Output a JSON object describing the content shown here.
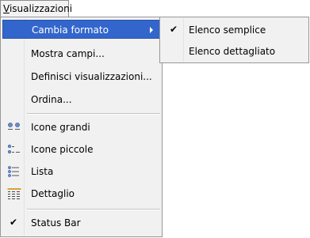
{
  "menubar": {
    "title": "Visualizzazioni",
    "mnemonic": "V",
    "rest": "isualizzazioni"
  },
  "menu": {
    "items": [
      {
        "label": "Cambia formato",
        "has_submenu": true,
        "highlighted": true
      },
      {
        "label": "Mostra campi..."
      },
      {
        "label": "Definisci visualizzazioni..."
      },
      {
        "label": "Ordina..."
      },
      {
        "label": "Icone grandi",
        "icon": "large-icons-icon"
      },
      {
        "label": "Icone piccole",
        "icon": "small-icons-icon"
      },
      {
        "label": "Lista",
        "icon": "list-icon"
      },
      {
        "label": "Dettaglio",
        "icon": "details-icon"
      },
      {
        "label": "Status Bar",
        "checked": true
      }
    ]
  },
  "submenu": {
    "items": [
      {
        "label": "Elenco semplice",
        "checked": true
      },
      {
        "label": "Elenco dettagliato"
      }
    ]
  },
  "colors": {
    "highlight": "#3366cc",
    "menu_bg": "#f1f1f1",
    "border": "#979797"
  }
}
